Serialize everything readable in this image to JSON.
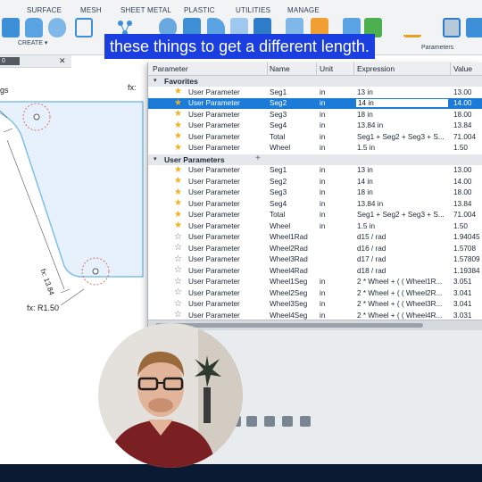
{
  "ribbon": {
    "tabs": [
      "SURFACE",
      "MESH",
      "SHEET METAL",
      "PLASTIC",
      "UTILITIES",
      "MANAGE"
    ],
    "create_label": "CREATE ▾",
    "params_label": "Parameters"
  },
  "caption": "these things to get a different length.",
  "canvas": {
    "header_label": "0",
    "close_glyph": "✕",
    "left_label": "gs",
    "fx_top": "fx:",
    "fx_side": "fx: 13.84",
    "fx_radius": "fx: R1.50"
  },
  "table": {
    "columns": [
      "Parameter",
      "Name",
      "Unit",
      "Expression",
      "Value"
    ],
    "favorites_label": "Favorites",
    "user_params_label": "User Parameters",
    "add_glyph": "+",
    "favorites": [
      {
        "param": "User Parameter",
        "name": "Seg1",
        "unit": "in",
        "expr": "13 in",
        "value": "13.00",
        "starred": true
      },
      {
        "param": "User Parameter",
        "name": "Seg2",
        "unit": "in",
        "expr": "14 in",
        "value": "14.00",
        "starred": true,
        "selected": true
      },
      {
        "param": "User Parameter",
        "name": "Seg3",
        "unit": "in",
        "expr": "18 in",
        "value": "18.00",
        "starred": true
      },
      {
        "param": "User Parameter",
        "name": "Seg4",
        "unit": "in",
        "expr": "13.84 in",
        "value": "13.84",
        "starred": true
      },
      {
        "param": "User Parameter",
        "name": "Total",
        "unit": "in",
        "expr": "Seg1 + Seg2 + Seg3 + S...",
        "value": "71.004",
        "starred": true
      },
      {
        "param": "User Parameter",
        "name": "Wheel",
        "unit": "in",
        "expr": "1.5 in",
        "value": "1.50",
        "starred": true
      }
    ],
    "user_params": [
      {
        "param": "User Parameter",
        "name": "Seg1",
        "unit": "in",
        "expr": "13 in",
        "value": "13.00",
        "starred": true
      },
      {
        "param": "User Parameter",
        "name": "Seg2",
        "unit": "in",
        "expr": "14 in",
        "value": "14.00",
        "starred": true
      },
      {
        "param": "User Parameter",
        "name": "Seg3",
        "unit": "in",
        "expr": "18 in",
        "value": "18.00",
        "starred": true
      },
      {
        "param": "User Parameter",
        "name": "Seg4",
        "unit": "in",
        "expr": "13.84 in",
        "value": "13.84",
        "starred": true
      },
      {
        "param": "User Parameter",
        "name": "Total",
        "unit": "in",
        "expr": "Seg1 + Seg2 + Seg3 + S...",
        "value": "71.004",
        "starred": true
      },
      {
        "param": "User Parameter",
        "name": "Wheel",
        "unit": "in",
        "expr": "1.5 in",
        "value": "1.50",
        "starred": true
      },
      {
        "param": "User Parameter",
        "name": "Wheel1Rad",
        "unit": "",
        "expr": "d15 / rad",
        "value": "1.94045",
        "starred": false
      },
      {
        "param": "User Parameter",
        "name": "Wheel2Rad",
        "unit": "",
        "expr": "d16 / rad",
        "value": "1.5708",
        "starred": false
      },
      {
        "param": "User Parameter",
        "name": "Wheel3Rad",
        "unit": "",
        "expr": "d17 / rad",
        "value": "1.57809",
        "starred": false
      },
      {
        "param": "User Parameter",
        "name": "Wheel4Rad",
        "unit": "",
        "expr": "d18 / rad",
        "value": "1.19384",
        "starred": false
      },
      {
        "param": "User Parameter",
        "name": "Wheel1Seg",
        "unit": "in",
        "expr": "2 * Wheel + ( ( Wheel1R...",
        "value": "3.051",
        "starred": false
      },
      {
        "param": "User Parameter",
        "name": "Wheel2Seg",
        "unit": "in",
        "expr": "2 * Wheel + ( ( Wheel2R...",
        "value": "3.041",
        "starred": false
      },
      {
        "param": "User Parameter",
        "name": "Wheel3Seg",
        "unit": "in",
        "expr": "2 * Wheel + ( ( Wheel3R...",
        "value": "3.041",
        "starred": false
      },
      {
        "param": "User Parameter",
        "name": "Wheel4Seg",
        "unit": "in",
        "expr": "2 * Wheel + ( ( Wheel4R...",
        "value": "3.031",
        "starred": false
      }
    ]
  },
  "colors": {
    "accent": "#1c7bd6",
    "star": "#f2b01e",
    "caption_bg": "#1a3ee0"
  }
}
